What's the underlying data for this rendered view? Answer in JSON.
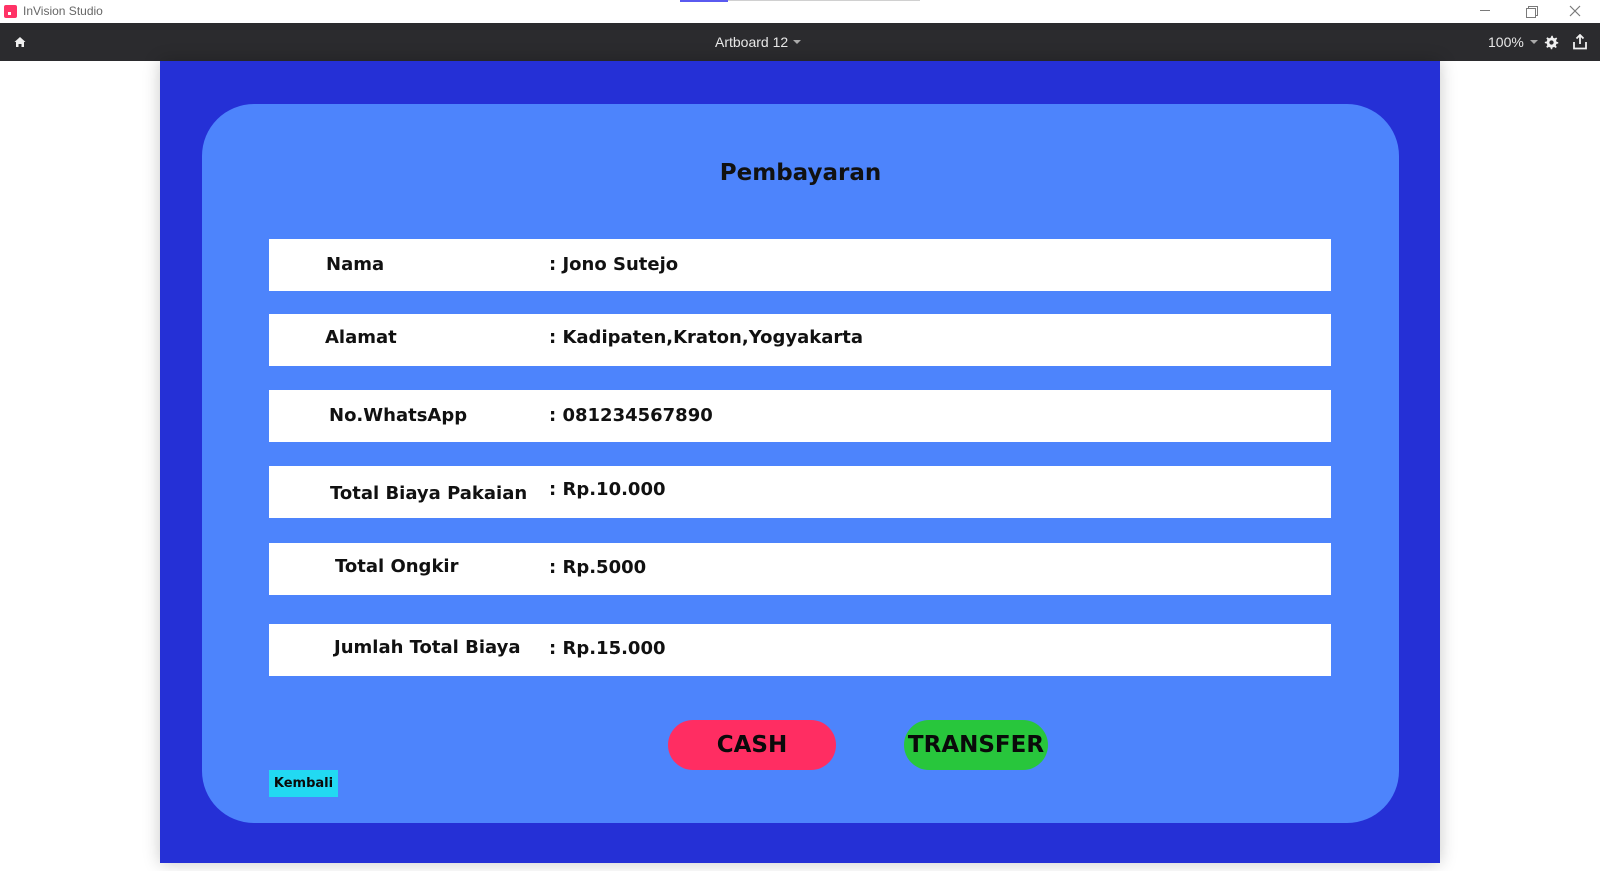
{
  "window": {
    "app_title": "InVision Studio",
    "artboard_name": "Artboard 12",
    "zoom_level": "100%"
  },
  "form": {
    "title": "Pembayaran",
    "rows": [
      {
        "label": "Nama",
        "value": ": Jono Sutejo"
      },
      {
        "label": "Alamat",
        "value": ": Kadipaten,Kraton,Yogyakarta"
      },
      {
        "label": "No.WhatsApp",
        "value": ": 081234567890"
      },
      {
        "label": "Total Biaya Pakaian",
        "value": ": Rp.10.000"
      },
      {
        "label": "Total Ongkir",
        "value": ": Rp.5000"
      },
      {
        "label": "Jumlah Total Biaya",
        "value": ": Rp.15.000"
      }
    ],
    "cash_label": "CASH",
    "transfer_label": "TRANSFER",
    "back_label": "Kembali"
  },
  "colors": {
    "artboard_bg": "#2530d6",
    "card_bg": "#4d84fc",
    "cash": "#ff2d62",
    "transfer": "#28c63c",
    "back": "#22d9f2",
    "toolbar": "#2b2b2e"
  },
  "icons": {
    "app": "invision-logo-icon",
    "home": "home-icon",
    "settings": "gear-icon",
    "export": "export-icon"
  }
}
